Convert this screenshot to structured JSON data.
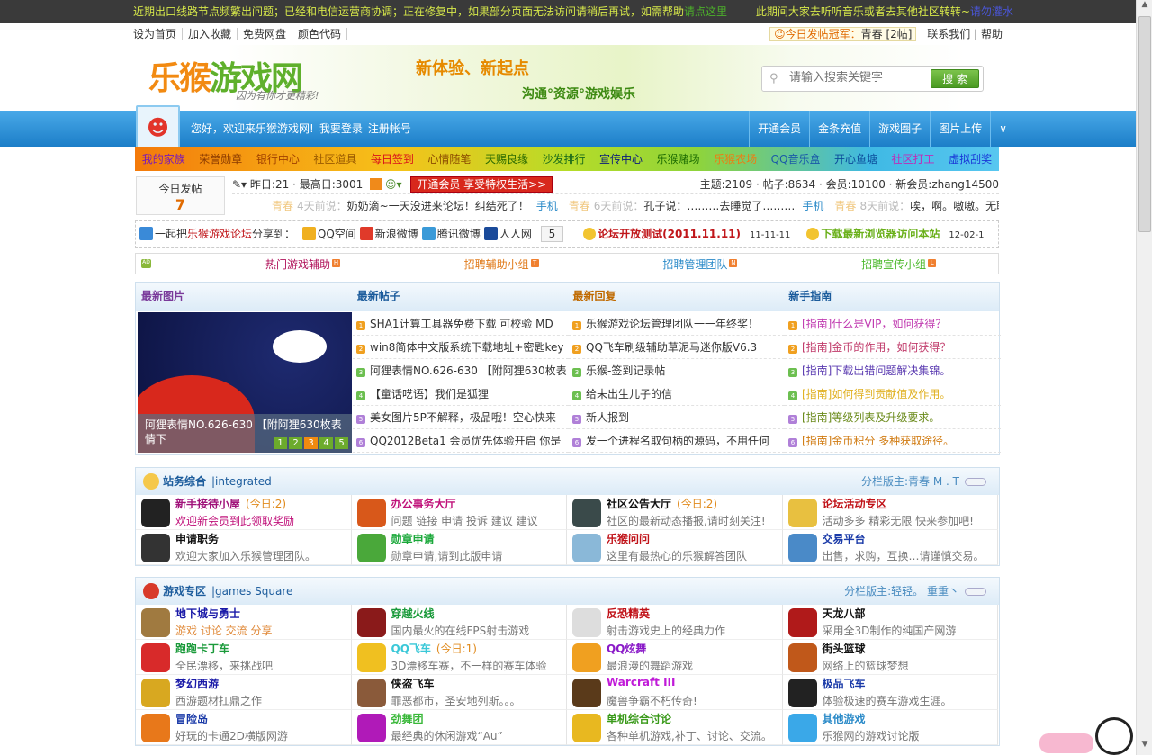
{
  "topbar": {
    "notice": "近期出口线路节点频繁出问题；已经和电信运营商协调；正在修复中，如果部分页面无法访问请稍后再试，如需帮助",
    "help_link": "请点这里",
    "notice2": "此期间大家去听听音乐或者去其他社区转转~",
    "link2": "请勿灌水"
  },
  "subnav": {
    "left": [
      "设为首页",
      "加入收藏",
      "免费网盘",
      "颜色代码"
    ],
    "champion_label": "今日发帖冠军：",
    "champion": "青春 [2帖]",
    "contact": "联系我们",
    "help": "帮助"
  },
  "header": {
    "logo": "乐猴游戏网",
    "slogan": "因为有你才更精彩!",
    "banner_title": "新体验、新起点",
    "banner_sub": "沟通°资源°游戏娱乐",
    "search_placeholder": "请输入搜索关键字",
    "search_button": "搜 索"
  },
  "nav": {
    "welcome": "您好，欢迎来乐猴游戏网!",
    "login": "我要登录",
    "register": "注册帐号",
    "right": [
      "开通会员",
      "金条充值",
      "游戏圈子",
      "图片上传"
    ],
    "more": "∨"
  },
  "menu": [
    {
      "label": "我的家族",
      "color": "#7a1ab8"
    },
    {
      "label": "荣誉勋章",
      "color": "#8a3a00"
    },
    {
      "label": "银行中心",
      "color": "#a04000"
    },
    {
      "label": "社区道具",
      "color": "#9a5a00"
    },
    {
      "label": "每日签到",
      "color": "#d8101a"
    },
    {
      "label": "心情随笔",
      "color": "#8a4a00"
    },
    {
      "label": "天赐良缘",
      "color": "#2a6a00"
    },
    {
      "label": "沙发排行",
      "color": "#1a6a1a"
    },
    {
      "label": "宣传中心",
      "color": "#0a1a7a"
    },
    {
      "label": "乐猴赌场",
      "color": "#1a6a00"
    },
    {
      "label": "乐猴农场",
      "color": "#f07a10"
    },
    {
      "label": "QQ音乐盒",
      "color": "#1a5aa8"
    },
    {
      "label": "开心鱼塘",
      "color": "#0a4a9a"
    },
    {
      "label": "社区打工",
      "color": "#c02ab8"
    },
    {
      "label": "虚拟刮奖",
      "color": "#1a3ad8"
    }
  ],
  "stats": {
    "today_label": "今日发帖",
    "today": "7",
    "yesterday": "昨日:21",
    "max": "最高日:3001",
    "vip": "开通会员 享受特权生活>>",
    "summary": "主题:2109 · 帖子:8634 · 会员:10100 · 新会员:zhang14500",
    "shouts": [
      {
        "user": "青春",
        "time": "4天前说：",
        "text": "奶奶滴~一天没进来论坛！纠结死了！",
        "via": "手机"
      },
      {
        "user": "青春",
        "time": "6天前说：",
        "text": "孔子说：………去睡觉了………",
        "via": "手机"
      },
      {
        "user": "青春",
        "time": "8天前说：",
        "text": "唉，啊。嗷嗷。无聊"
      }
    ]
  },
  "share": {
    "prefix": "一起把",
    "site": "乐猴游戏论坛",
    "suffix": "分享到：",
    "targets": [
      "QQ空间",
      "新浪微博",
      "腾讯微博",
      "人人网"
    ],
    "count": "5",
    "notices": [
      {
        "text": "论坛开放测试(2011.11.11)",
        "date": "11-11-11",
        "color": "#c0161a"
      },
      {
        "text": "下载最新浏览器访问本站",
        "date": "12-02-1",
        "color": "#6ab01a"
      }
    ]
  },
  "ads": {
    "tag": "AD",
    "items": [
      {
        "label": "热门游戏辅助",
        "badge": "H",
        "color": "#b0125a"
      },
      {
        "label": "招聘辅助小组",
        "badge": "T",
        "color": "#e07a1a"
      },
      {
        "label": "招聘管理团队",
        "badge": "N",
        "color": "#2a8ac8"
      },
      {
        "label": "招聘宣传小组",
        "badge": "L",
        "color": "#4ab82a"
      }
    ]
  },
  "latest": {
    "headers": [
      "最新图片",
      "最新帖子",
      "最新回复",
      "新手指南"
    ],
    "header_colors": [
      "#7a3a9a",
      "#1c5c9c",
      "#c06a00",
      "#1c5c9c"
    ],
    "caption": "阿狸表情NO.626-630 【附阿狸630枚表情下",
    "pages": [
      "1",
      "2",
      "3",
      "4",
      "5"
    ],
    "active_page": 3,
    "num_colors": [
      "#f0a020",
      "#f0a020",
      "#6cbf50",
      "#6cbf50",
      "#b080d8",
      "#b080d8"
    ],
    "posts": [
      "SHA1计算工具器免费下载 可校验 MD",
      "win8简体中文版系统下载地址+密匙key",
      "阿狸表情NO.626-630 【附阿狸630枚表",
      "【童话呓语】我们是狐狸",
      "美女图片5P不解释，极品哦！空心快来",
      "QQ2012Beta1 会员优先体验开启 你是"
    ],
    "replies": [
      "乐猴游戏论坛管理团队一一年终奖！",
      "QQ飞车刷级辅助草泥马迷你版V6.3",
      "乐猴-签到记录帖",
      "给未出生儿子的信",
      "新人报到",
      "发一个进程名取句柄的源码，不用任何"
    ],
    "guides": [
      {
        "text": "[指南]什么是VIP，如何获得？",
        "color": "#c03ab0"
      },
      {
        "text": "[指南]金币的作用，如何获得？",
        "color": "#c03a6a"
      },
      {
        "text": "[指南]下载出错问题解决集锦。",
        "color": "#5a3ab0"
      },
      {
        "text": "[指南]如何得到贡献值及作用。",
        "color": "#e0b020"
      },
      {
        "text": "[指南]等级列表及升级要求。",
        "color": "#6a8a1a"
      },
      {
        "text": "[指南]金币积分 多种获取途径。",
        "color": "#d07a10"
      }
    ]
  },
  "sections": [
    {
      "title": "站务综合",
      "en": "|integrated",
      "moderator": "分栏版主:青春 M . T",
      "icon_color": "#f5c84a",
      "forums": [
        {
          "name": "新手接待小屋",
          "today": "(今日:2)",
          "desc": "欢迎新会员到此领取奖励",
          "color": "#a0127a",
          "desc_color": "#c0127a",
          "icon": "#222"
        },
        {
          "name": "办公事务大厅",
          "desc": "问题 链接 申请 投诉 建议 建议",
          "color": "#c0127a",
          "icon": "#d8581a"
        },
        {
          "name": "社区公告大厅",
          "today": "(今日:2)",
          "desc": "社区的最新动态播报,请时刻关注!",
          "color": "#111",
          "icon": "#3a4a4a"
        },
        {
          "name": "论坛活动专区",
          "desc": "活动多多 精彩无限 快来参加吧!",
          "color": "#c01218",
          "icon": "#e8c040"
        },
        {
          "name": "申请职务",
          "desc": "欢迎大家加入乐猴管理团队。",
          "color": "#111",
          "icon": "#333"
        },
        {
          "name": "勋章申请",
          "desc": "勋章申请,请到此版申请",
          "color": "#1aa83a",
          "icon": "#4aa83a"
        },
        {
          "name": "乐猴问问",
          "desc": "这里有最热心的乐猴解答团队",
          "color": "#c01218",
          "icon": "#8ab8d8"
        },
        {
          "name": "交易平台",
          "desc": "出售，求购，互换…请谨慎交易。",
          "color": "#1a3aa8",
          "icon": "#4a8ac8"
        }
      ]
    },
    {
      "title": "游戏专区",
      "en": "|games Square",
      "moderator": "分栏版主:轻轻。 重重丶",
      "icon_color": "#d83a2a",
      "forums": [
        {
          "name": "地下城与勇士",
          "desc": "游戏 讨论 交流 分享",
          "color": "#1a1aa8",
          "desc_color": "#e08a3a",
          "icon": "#a07a40"
        },
        {
          "name": "穿越火线",
          "desc": "国内最火的在线FPS射击游戏",
          "color": "#1a9a3a",
          "icon": "#8a1a1a"
        },
        {
          "name": "反恐精英",
          "desc": "射击游戏史上的经典力作",
          "color": "#c01218",
          "icon": "#ddd"
        },
        {
          "name": "天龙八部",
          "desc": "采用全3D制作的纯国产网游",
          "color": "#111",
          "icon": "#b01a1a"
        },
        {
          "name": "跑跑卡丁车",
          "desc": "全民漂移，来挑战吧",
          "color": "#1a9a3a",
          "icon": "#d82a2a"
        },
        {
          "name": "QQ飞车",
          "today": "(今日:1)",
          "desc": "3D漂移车赛，不一样的赛车体验",
          "color": "#3ac8d8",
          "icon": "#f0c020"
        },
        {
          "name": "QQ炫舞",
          "desc": "最浪漫的舞蹈游戏",
          "color": "#8a1ac8",
          "icon": "#f0a020"
        },
        {
          "name": "街头篮球",
          "desc": "网络上的篮球梦想",
          "color": "#111",
          "icon": "#c0581a"
        },
        {
          "name": "梦幻西游",
          "desc": "西游题材扛鼎之作",
          "color": "#1a1aa8",
          "icon": "#d8a820"
        },
        {
          "name": "侠盗飞车",
          "desc": "罪恶都市，圣安地列斯。。。",
          "color": "#111",
          "icon": "#8a5a3a"
        },
        {
          "name": "Warcraft III",
          "desc": "魔兽争霸不朽传奇!",
          "color": "#c01ad8",
          "icon": "#5a3a1a"
        },
        {
          "name": "极品飞车",
          "desc": "体验极速的赛车游戏生涯。",
          "color": "#1a3aa8",
          "icon": "#222"
        },
        {
          "name": "冒险岛",
          "desc": "好玩的卡通2D横版网游",
          "color": "#1a3aa8",
          "icon": "#e8781a"
        },
        {
          "name": "劲舞团",
          "desc": "最经典的休闲游戏“Au”",
          "color": "#3ab83a",
          "icon": "#b01ab8"
        },
        {
          "name": "单机综合讨论",
          "desc": "各种单机游戏,补丁、讨论、交流。",
          "color": "#3a9a1a",
          "icon": "#e8b820"
        },
        {
          "name": "其他游戏",
          "desc": "乐猴网的游戏讨论版",
          "color": "#2a8ac8",
          "icon": "#3aa8e8"
        }
      ]
    }
  ]
}
